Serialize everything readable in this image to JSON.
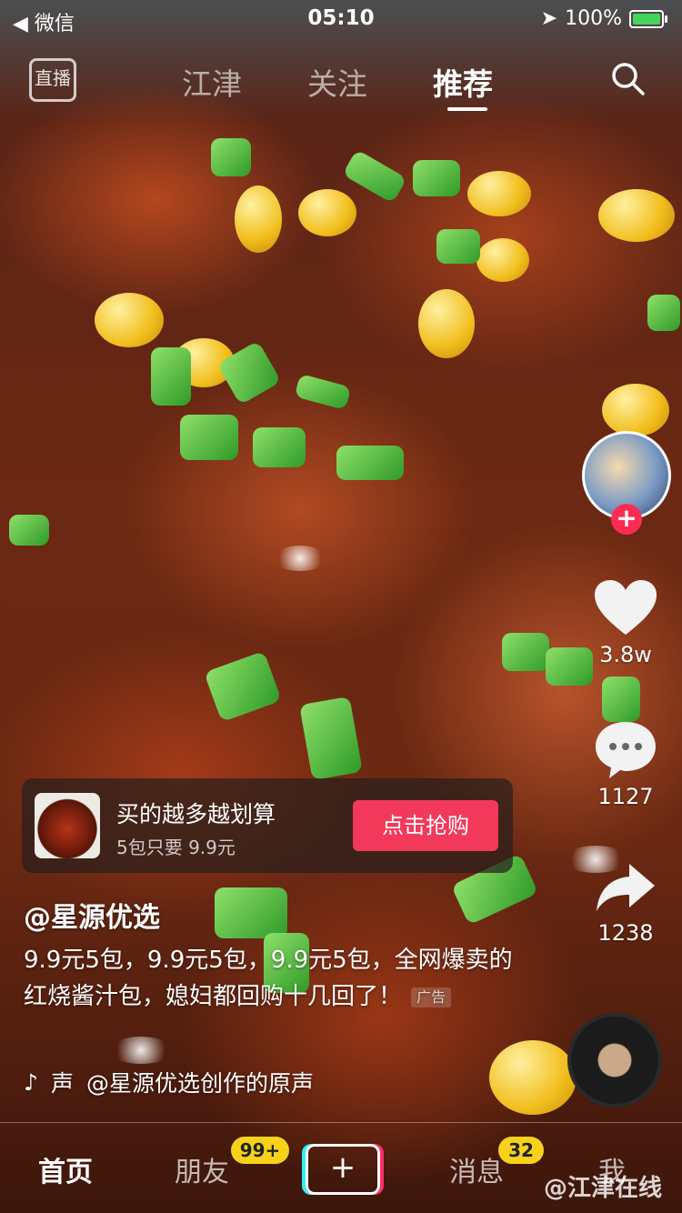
{
  "status_bar": {
    "back_label": "◀ 微信",
    "time": "05:10",
    "battery_percent": "100%"
  },
  "top_nav": {
    "live_label": "直播",
    "tabs": [
      "江津",
      "关注",
      "推荐"
    ],
    "active_tab": "推荐"
  },
  "rail": {
    "likes": "3.8w",
    "comments": "1127",
    "shares": "1238"
  },
  "ad": {
    "title": "买的越多越划算",
    "subtitle": "5包只要 9.9元",
    "button": "点击抢购"
  },
  "post": {
    "author": "@星源优选",
    "caption": "9.9元5包，9.9元5包，9.9元5包，全网爆卖的红烧酱汁包，媳妇都回购十几回了！",
    "ad_tag": "广告",
    "music_prefix": "声",
    "music_text": "@星源优选创作的原声"
  },
  "bottom_nav": {
    "home": "首页",
    "friends": "朋友",
    "friends_badge": "99+",
    "create": "+",
    "messages": "消息",
    "messages_badge": "32",
    "me": "我"
  },
  "watermark": "@江津在线",
  "colors": {
    "accent": "#fe2c55",
    "badge": "#f7d21a",
    "battery": "#46d35a"
  }
}
